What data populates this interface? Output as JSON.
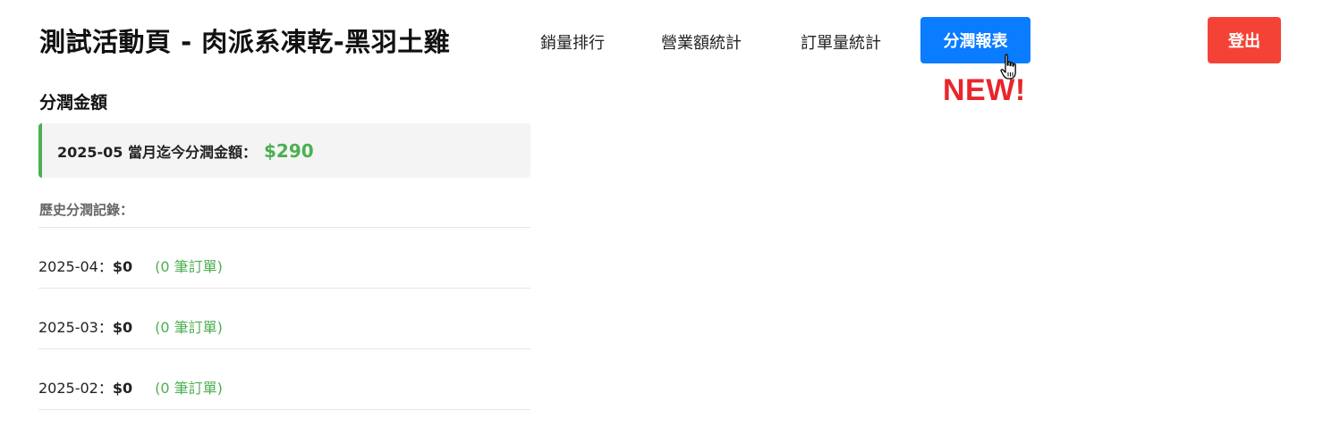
{
  "header": {
    "title": "測試活動頁 - 肉派系凍乾-黑羽土雞",
    "nav": [
      {
        "label": "銷量排行"
      },
      {
        "label": "營業額統計"
      },
      {
        "label": "訂單量統計"
      },
      {
        "label": "分潤報表",
        "active": true
      }
    ],
    "new_badge": "NEW!",
    "logout_label": "登出"
  },
  "profit": {
    "section_title": "分潤金額",
    "current_label": "2025-05 當月迄今分潤金額：",
    "current_value": "$290",
    "history_title": "歷史分潤記錄：",
    "history": [
      {
        "month": "2025-04：",
        "amount": "$0",
        "orders": "(0 筆訂單)"
      },
      {
        "month": "2025-03：",
        "amount": "$0",
        "orders": "(0 筆訂單)"
      },
      {
        "month": "2025-02：",
        "amount": "$0",
        "orders": "(0 筆訂單)"
      }
    ]
  },
  "colors": {
    "active_nav": "#0a7cff",
    "logout": "#f44336",
    "new_badge": "#e8262d",
    "accent_green": "#4caf50"
  },
  "icons": {
    "cursor": "hand-pointer-cursor-icon"
  }
}
